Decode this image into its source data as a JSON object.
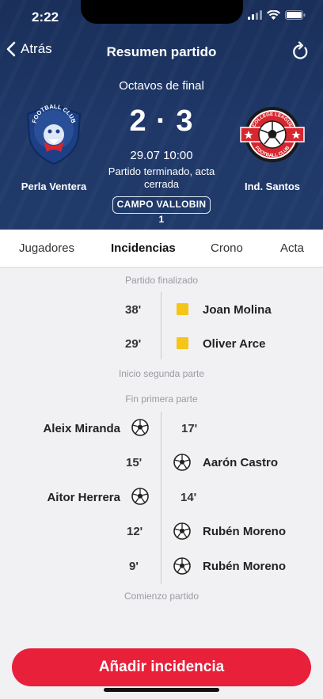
{
  "status_bar": {
    "time": "2:22"
  },
  "nav": {
    "back_label": "Atrás",
    "title": "Resumen partido"
  },
  "match": {
    "round": "Octavos de final",
    "score": "2 · 3",
    "datetime": "29.07 10:00",
    "status": "Partido terminado, acta cerrada",
    "field": "CAMPO VALLOBIN 1",
    "home": {
      "name": "Perla Ventera",
      "crest_text": "FOOTBALL CLUB"
    },
    "away": {
      "name": "Ind. Santos",
      "crest_text_top": "COLLEGE LEAGUE",
      "crest_text_bottom": "FOOTBALL CLUB"
    }
  },
  "tabs": [
    "Jugadores",
    "Incidencias",
    "Crono",
    "Acta"
  ],
  "active_tab": "Incidencias",
  "timeline": {
    "phases": {
      "end": "Partido finalizado",
      "second_half_start": "Inicio segunda parte",
      "first_half_end": "Fin primera parte",
      "start": "Comienzo partido"
    },
    "events": [
      {
        "minute": "38'",
        "player": "Joan Molina",
        "type": "yellow-card",
        "side": "away"
      },
      {
        "minute": "29'",
        "player": "Oliver Arce",
        "type": "yellow-card",
        "side": "away"
      },
      {
        "minute": "17'",
        "player": "Aleix Miranda",
        "type": "goal",
        "side": "home"
      },
      {
        "minute": "15'",
        "player": "Aarón Castro",
        "type": "goal",
        "side": "away"
      },
      {
        "minute": "14'",
        "player": "Aitor Herrera",
        "type": "goal",
        "side": "home"
      },
      {
        "minute": "12'",
        "player": "Rubén Moreno",
        "type": "goal",
        "side": "away"
      },
      {
        "minute": "9'",
        "player": "Rubén Moreno",
        "type": "goal",
        "side": "away"
      }
    ]
  },
  "action_button": {
    "label": "Añadir incidencia"
  },
  "colors": {
    "header": "#1f3868",
    "accent": "#e8203a",
    "card": "#f5c518"
  }
}
